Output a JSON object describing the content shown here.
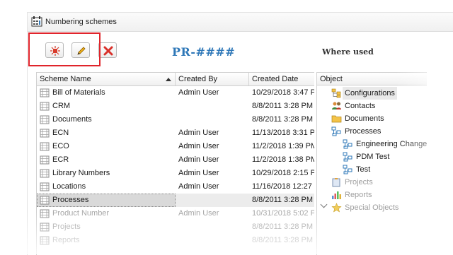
{
  "window": {
    "title": "Numbering schemes"
  },
  "toolbar": {
    "new_icon": "new-scheme-icon",
    "edit_icon": "pencil-icon",
    "delete_icon": "delete-x-icon",
    "scheme_preview": "PR-####",
    "where_used_label": "Where used"
  },
  "grid": {
    "columns": {
      "name": "Scheme Name",
      "created_by": "Created By",
      "created_date": "Created Date"
    },
    "rows": [
      {
        "name": "Bill of Materials",
        "created_by": "Admin User",
        "created_date": "10/29/2018 3:47 P"
      },
      {
        "name": "CRM",
        "created_by": "",
        "created_date": "8/8/2011 3:28 PM"
      },
      {
        "name": "Documents",
        "created_by": "",
        "created_date": "8/8/2011 3:28 PM"
      },
      {
        "name": "ECN",
        "created_by": "Admin User",
        "created_date": "11/13/2018 3:31 P"
      },
      {
        "name": "ECO",
        "created_by": "Admin User",
        "created_date": "11/2/2018 1:39 PM"
      },
      {
        "name": "ECR",
        "created_by": "Admin User",
        "created_date": "11/2/2018 1:38 PM"
      },
      {
        "name": "Library Numbers",
        "created_by": "Admin User",
        "created_date": "10/29/2018 2:15 P"
      },
      {
        "name": "Locations",
        "created_by": "Admin User",
        "created_date": "11/16/2018 12:27"
      },
      {
        "name": "Processes",
        "created_by": "",
        "created_date": "8/8/2011 3:28 PM"
      },
      {
        "name": "Product Number",
        "created_by": "Admin User",
        "created_date": "10/31/2018 5:02 P"
      },
      {
        "name": "Projects",
        "created_by": "",
        "created_date": "8/8/2011 3:28 PM"
      },
      {
        "name": "Reports",
        "created_by": "",
        "created_date": "8/8/2011 3:28 PM"
      }
    ],
    "selected_row": "Processes"
  },
  "tree": {
    "header": "Object",
    "nodes": [
      {
        "label": "Configurations",
        "icon": "configurations-icon",
        "level": 0
      },
      {
        "label": "Contacts",
        "icon": "contacts-icon",
        "level": 0
      },
      {
        "label": "Documents",
        "icon": "folder-icon",
        "level": 0
      },
      {
        "label": "Processes",
        "icon": "processes-icon",
        "level": 0,
        "expanded": true
      },
      {
        "label": "Engineering Change",
        "icon": "process-icon",
        "level": 1
      },
      {
        "label": "PDM Test",
        "icon": "process-icon",
        "level": 1
      },
      {
        "label": "Test",
        "icon": "process-icon",
        "level": 1
      },
      {
        "label": "Projects",
        "icon": "projects-icon",
        "level": 0
      },
      {
        "label": "Reports",
        "icon": "reports-icon",
        "level": 0
      },
      {
        "label": "Special Objects",
        "icon": "star-icon",
        "level": 0
      }
    ]
  },
  "colors": {
    "accent": "#2f78b8",
    "highlight_border": "#e0242b"
  }
}
